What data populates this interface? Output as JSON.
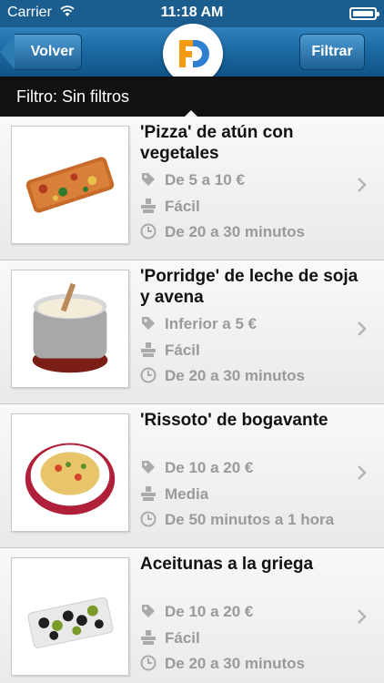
{
  "status_bar": {
    "carrier": "Carrier",
    "time": "11:18 AM",
    "wifi_icon": "wifi-icon",
    "battery_icon": "battery-icon"
  },
  "nav": {
    "back_label": "Volver",
    "filter_label": "Filtrar",
    "logo": "FD"
  },
  "filter_bar": {
    "text": "Filtro: Sin filtros"
  },
  "colors": {
    "nav": "#1b6aa3",
    "filter_bar": "#111111",
    "text_secondary": "#9a9a9a",
    "logo_orange": "#f39c12",
    "logo_blue": "#2f7fd1"
  },
  "recipes": [
    {
      "title": "'Pizza' de atún con vegetales",
      "price": "De 5 a 10 €",
      "difficulty": "Fácil",
      "time": "De 20 a 30 minutos"
    },
    {
      "title": "'Porridge' de leche de soja y avena",
      "price": "Inferior a 5 €",
      "difficulty": "Fácil",
      "time": "De 20 a 30 minutos"
    },
    {
      "title": "'Rissoto' de bogavante",
      "price": "De 10 a 20 €",
      "difficulty": "Media",
      "time": "De 50 minutos a 1 hora"
    },
    {
      "title": "Aceitunas a la griega",
      "price": "De 10 a 20 €",
      "difficulty": "Fácil",
      "time": "De 20 a 30 minutos"
    }
  ]
}
